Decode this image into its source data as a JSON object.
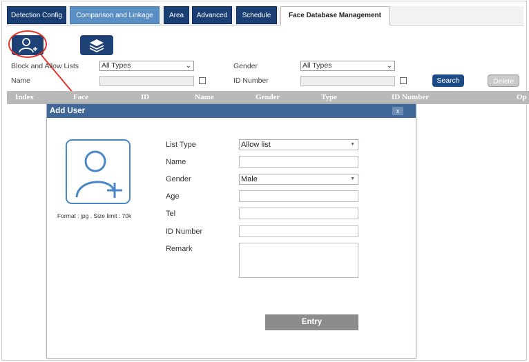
{
  "tabs": [
    {
      "label": "Detection Config"
    },
    {
      "label": "Comparison and Linkage"
    },
    {
      "label": "Area"
    },
    {
      "label": "Advanced"
    },
    {
      "label": "Schedule"
    },
    {
      "label": "Face Database Management"
    }
  ],
  "toolbar": {
    "add_user_icon": "add-user-icon",
    "layers_icon": "layers-icon",
    "highlight_color": "#e8332a"
  },
  "filters": {
    "block_allow_label": "Block and Allow Lists",
    "block_allow_value": "All Types",
    "gender_label": "Gender",
    "gender_value": "All Types",
    "name_label": "Name",
    "name_value": "",
    "id_number_label": "ID Number",
    "id_number_value": "",
    "search_label": "Search",
    "delete_label": "Delete"
  },
  "table": {
    "columns": [
      "Index",
      "Face",
      "ID",
      "Name",
      "Gender",
      "Type",
      "ID Number",
      "Op"
    ]
  },
  "modal": {
    "title": "Add User",
    "close_label": "x",
    "format_hint": "Format : jpg . Size limit : 70k",
    "fields": {
      "list_type_label": "List Type",
      "list_type_value": "Allow list",
      "name_label": "Name",
      "name_value": "",
      "gender_label": "Gender",
      "gender_value": "Male",
      "age_label": "Age",
      "age_value": "",
      "tel_label": "Tel",
      "tel_value": "",
      "id_number_label": "ID Number",
      "id_number_value": "",
      "remark_label": "Remark",
      "remark_value": ""
    },
    "entry_label": "Entry"
  },
  "colors": {
    "tab_dark": "#1a3f75",
    "tab_light": "#5a8fc6",
    "modal_header": "#3f6797",
    "search_button": "#1e4a86",
    "arrow": "#e8332a"
  }
}
